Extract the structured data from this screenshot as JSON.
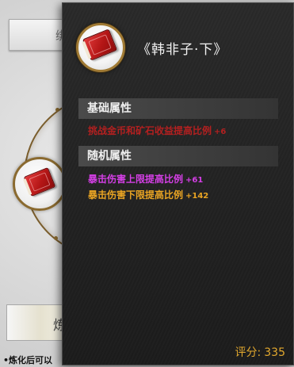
{
  "background": {
    "top_button_label": "绑",
    "refine_button_label": "炼",
    "note_text": "•炼化后可以"
  },
  "tooltip": {
    "item_name": "《韩非子·下》",
    "item_icon": "red-book-icon",
    "sections": {
      "base": {
        "title": "基础属性",
        "stats": [
          {
            "label": "挑战金币和矿石收益提高比例",
            "bonus": "+6",
            "color": "#b32020"
          }
        ]
      },
      "random": {
        "title": "随机属性",
        "stats": [
          {
            "label": "暴击伤害上限提高比例",
            "bonus": "+61",
            "color": "#d53fe6"
          },
          {
            "label": "暴击伤害下限提高比例",
            "bonus": "+142",
            "color": "#e9a423"
          }
        ]
      }
    },
    "score_label": "评分:",
    "score_value": "335"
  }
}
